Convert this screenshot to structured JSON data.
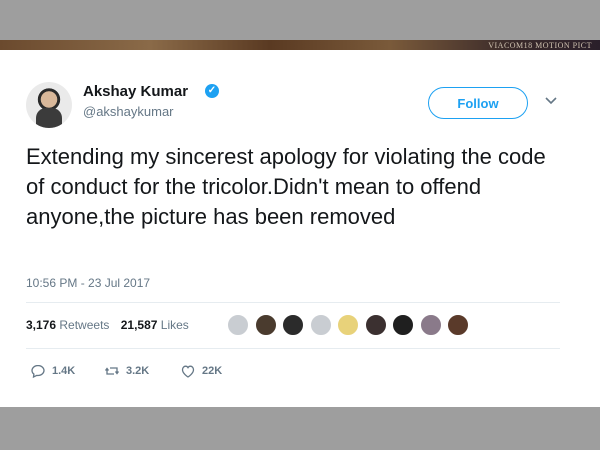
{
  "header_banner": {
    "watermark": "VIACOM18 MOTION PICT"
  },
  "tweet": {
    "author": {
      "name": "Akshay Kumar",
      "handle": "@akshaykumar",
      "verified": true
    },
    "follow_label": "Follow",
    "text": "Extending my sincerest apology for violating the code of conduct for the tricolor.Didn't mean to offend anyone,the picture has been removed",
    "timestamp": "10:56 PM - 23 Jul 2017",
    "stats": {
      "retweets_count": "3,176",
      "retweets_label": "Retweets",
      "likes_count": "21,587",
      "likes_label": "Likes"
    },
    "liker_avatars": [
      {
        "name": "liker-avatar-1",
        "color": "#c9cdd2"
      },
      {
        "name": "liker-avatar-2",
        "color": "#4a3b2e"
      },
      {
        "name": "liker-avatar-3",
        "color": "#2b2b2b"
      },
      {
        "name": "liker-avatar-4",
        "color": "#c9cdd2"
      },
      {
        "name": "liker-avatar-5",
        "color": "#e8d27a"
      },
      {
        "name": "liker-avatar-6",
        "color": "#3b3030"
      },
      {
        "name": "liker-avatar-7",
        "color": "#1f1f1f"
      },
      {
        "name": "liker-avatar-8",
        "color": "#8a7a8a"
      },
      {
        "name": "liker-avatar-9",
        "color": "#5a3a2a"
      }
    ],
    "actions": {
      "replies": "1.4K",
      "retweets": "3.2K",
      "likes": "22K"
    }
  },
  "colors": {
    "accent": "#1da1f2",
    "text_primary": "#14171a",
    "text_secondary": "#657786",
    "background": "#9e9e9e"
  }
}
